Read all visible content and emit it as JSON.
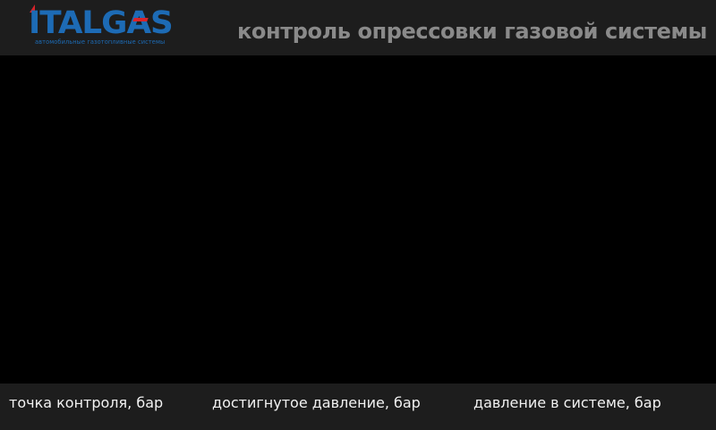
{
  "header": {
    "logo": {
      "wordmark": "ITALGAS",
      "tagline": "автомобильные газотопливные системы"
    },
    "title": "контроль опрессовки газовой системы"
  },
  "footer": {
    "labels": [
      "точка контроля, бар",
      "достигнутое давление, бар",
      "давление в системе, бар"
    ]
  },
  "colors": {
    "background": "#000000",
    "bar_background": "#1d1d1d",
    "title_text": "#8a8a8a",
    "footer_text": "#f2f2f2",
    "brand_blue": "#1d6bb5",
    "brand_red": "#d8232a"
  }
}
